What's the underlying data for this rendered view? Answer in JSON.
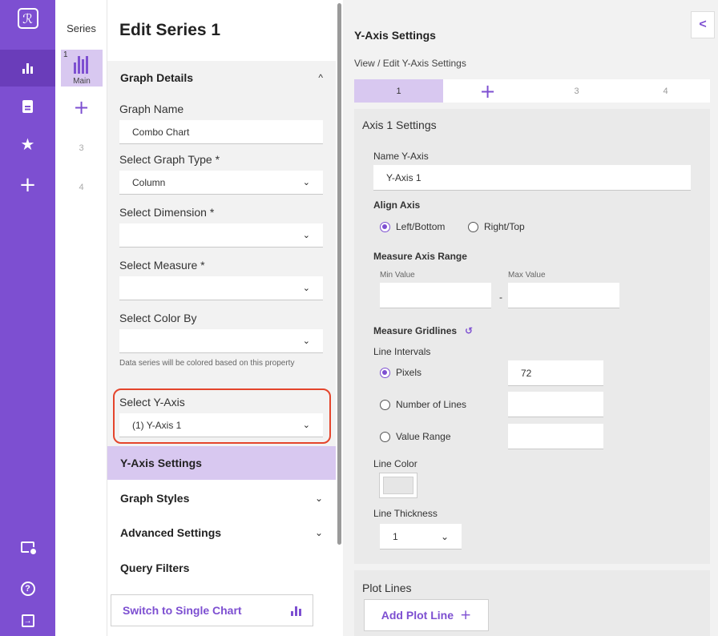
{
  "series_panel": {
    "title": "Series",
    "main_item": {
      "number": "1",
      "label": "Main"
    },
    "slots": [
      "3",
      "4"
    ]
  },
  "edit_panel": {
    "title": "Edit Series 1",
    "graph_details": {
      "header": "Graph Details",
      "graph_name": {
        "label": "Graph Name",
        "value": "Combo Chart"
      },
      "graph_type": {
        "label": "Select Graph Type *",
        "value": "Column"
      },
      "dimension": {
        "label": "Select Dimension *",
        "value": ""
      },
      "measure": {
        "label": "Select Measure *",
        "value": ""
      },
      "color_by": {
        "label": "Select Color By",
        "value": "",
        "hint": "Data series will be colored based on this property"
      },
      "y_axis": {
        "label": "Select Y-Axis",
        "value": "(1) Y-Axis 1"
      }
    },
    "sections": {
      "y_axis_settings": "Y-Axis Settings",
      "graph_styles": "Graph Styles",
      "advanced_settings": "Advanced Settings",
      "query_filters": "Query Filters"
    },
    "switch_button": "Switch to Single Chart"
  },
  "y_axis_panel": {
    "title": "Y-Axis Settings",
    "subtitle": "View / Edit Y-Axis Settings",
    "tabs": [
      "1",
      "+",
      "3",
      "4"
    ],
    "active_tab": "1",
    "axis_settings": {
      "title": "Axis 1 Settings",
      "name_label": "Name Y-Axis",
      "name_value": "Y-Axis 1",
      "align_label": "Align Axis",
      "align_options": [
        "Left/Bottom",
        "Right/Top"
      ],
      "align_selected": "Left/Bottom",
      "range_label": "Measure Axis Range",
      "min_label": "Min Value",
      "max_label": "Max Value",
      "range_sep": "-",
      "gridlines_label": "Measure Gridlines",
      "intervals_label": "Line Intervals",
      "interval_options": [
        "Pixels",
        "Number of Lines",
        "Value Range"
      ],
      "interval_selected": "Pixels",
      "pixels_value": "72",
      "line_color_label": "Line Color",
      "line_color": "#e6e6e6",
      "thickness_label": "Line Thickness",
      "thickness_value": "1"
    },
    "plot_lines": {
      "title": "Plot Lines",
      "add_button": "Add Plot Line"
    }
  },
  "icons": {
    "rail": [
      "logo-icon",
      "chart-icon",
      "document-icon",
      "star-icon",
      "plus-icon",
      "card-settings-icon",
      "help-icon",
      "exit-icon"
    ],
    "chevron": "⌄",
    "collapse": "<"
  },
  "colors": {
    "accent": "#7d4fd1",
    "highlight_border": "#e4452c",
    "active_fill": "#d8c8f0"
  }
}
